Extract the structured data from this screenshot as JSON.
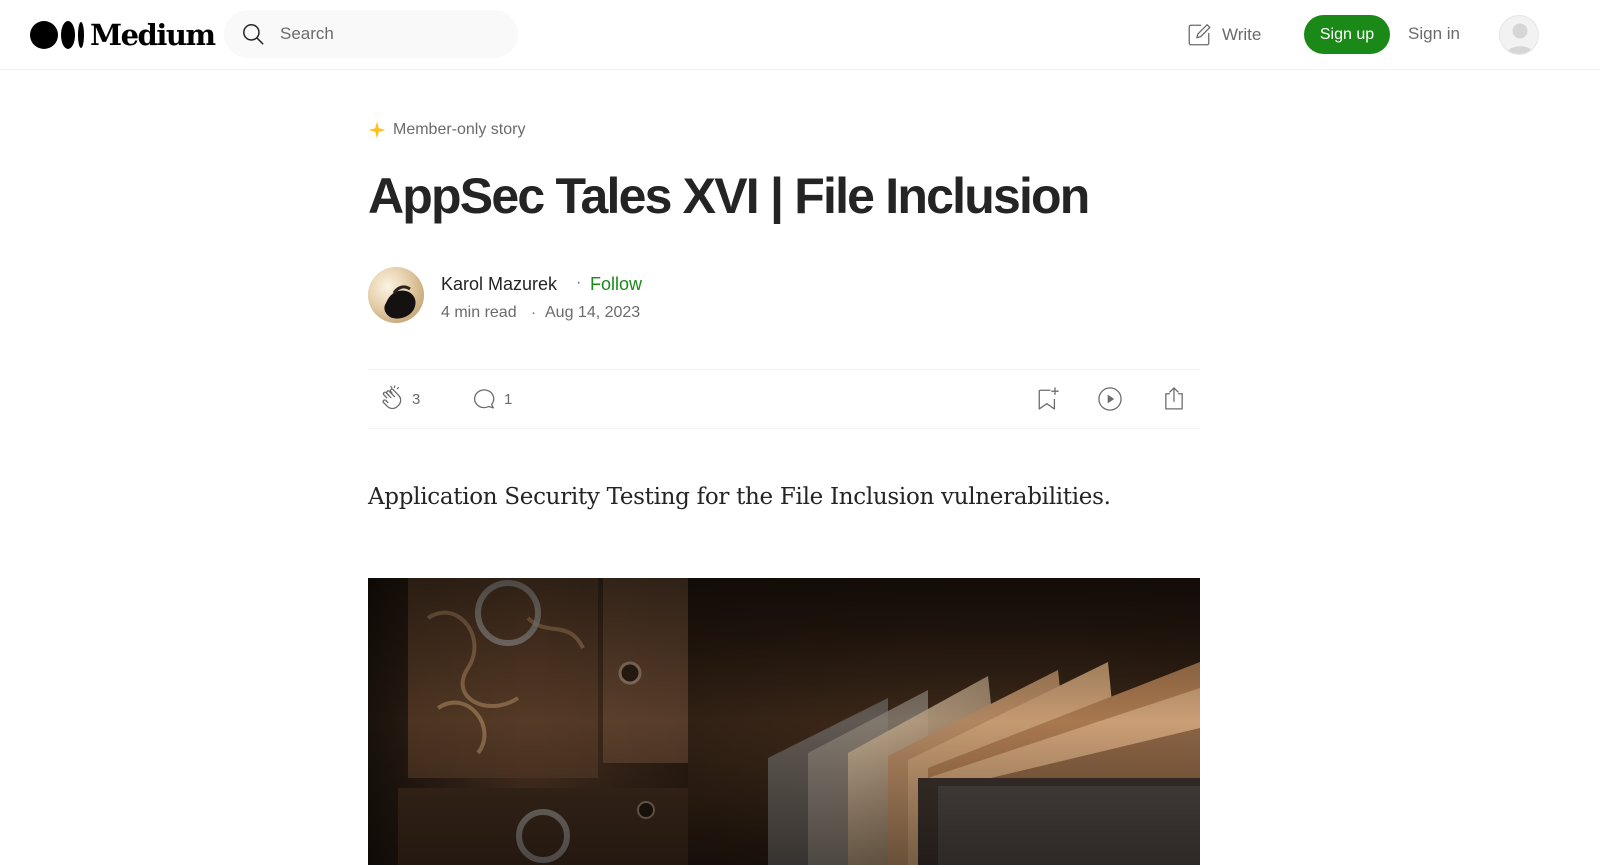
{
  "brand": {
    "name": "Medium"
  },
  "search": {
    "placeholder": "Search"
  },
  "header": {
    "write_label": "Write",
    "signup_label": "Sign up",
    "signin_label": "Sign in"
  },
  "article": {
    "badge": "Member-only story",
    "title": "AppSec Tales XVI | File Inclusion",
    "author": "Karol Mazurek",
    "follow_label": "Follow",
    "separator": "·",
    "read_time": "4 min read",
    "date": "Aug 14, 2023",
    "claps": "3",
    "responses": "1",
    "lead": "Application Security Testing for the File Inclusion vulnerabilities."
  },
  "colors": {
    "accent_green": "#1a8917",
    "member_star": "#ffc017",
    "text_primary": "#242424",
    "text_secondary": "#6b6b6b"
  },
  "icons": [
    "search-icon",
    "write-icon",
    "user-avatar-icon",
    "star-icon",
    "clap-icon",
    "comment-icon",
    "bookmark-icon",
    "play-icon",
    "share-icon"
  ]
}
